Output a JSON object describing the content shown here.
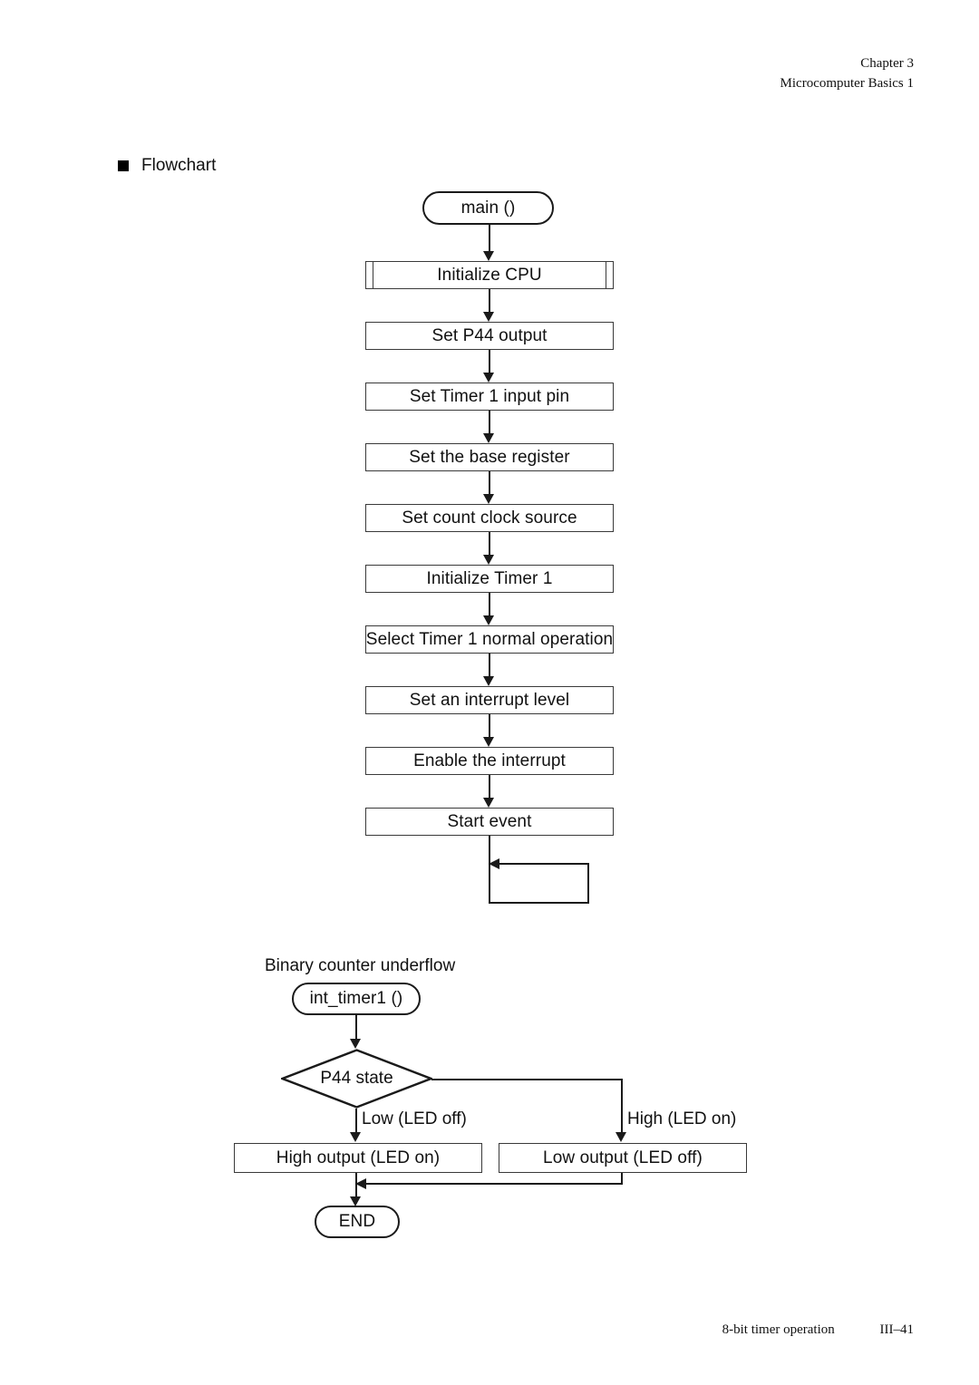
{
  "header": {
    "line1": "Chapter 3",
    "line2": "Microcomputer Basics 1"
  },
  "footer": {
    "caption": "8-bit timer operation",
    "page_number": "III–41"
  },
  "section": {
    "title": "Flowchart",
    "bullet": "filled-square-bullet"
  },
  "main_flow": {
    "start": "main ()",
    "steps": [
      {
        "label": "Initialize CPU",
        "shape": "predefined-process"
      },
      {
        "label": "Set P44 output",
        "shape": "process"
      },
      {
        "label": "Set Timer 1 input pin",
        "shape": "process"
      },
      {
        "label": "Set the base register",
        "shape": "process"
      },
      {
        "label": "Set count clock source",
        "shape": "process"
      },
      {
        "label": "Initialize Timer 1",
        "shape": "process"
      },
      {
        "label": "Select Timer 1 normal operation",
        "shape": "process"
      },
      {
        "label": "Set an interrupt level",
        "shape": "process"
      },
      {
        "label": "Enable the interrupt",
        "shape": "process"
      },
      {
        "label": "Start event",
        "shape": "process"
      }
    ],
    "loop": "infinite-loop-back"
  },
  "interrupt_flow": {
    "trigger_note": "Binary counter underflow",
    "entry": "int_timer1 ()",
    "decision": "P44 state",
    "branch_left_label": "Low (LED off)",
    "branch_right_label": "High (LED on)",
    "branch_left_action": "High output (LED on)",
    "branch_right_action": "Low output (LED off)",
    "end": "END"
  },
  "colors": {
    "ink": "#111111",
    "box_stroke": "#3a3a3a",
    "line": "#1a1a1a",
    "paper": "#ffffff"
  }
}
